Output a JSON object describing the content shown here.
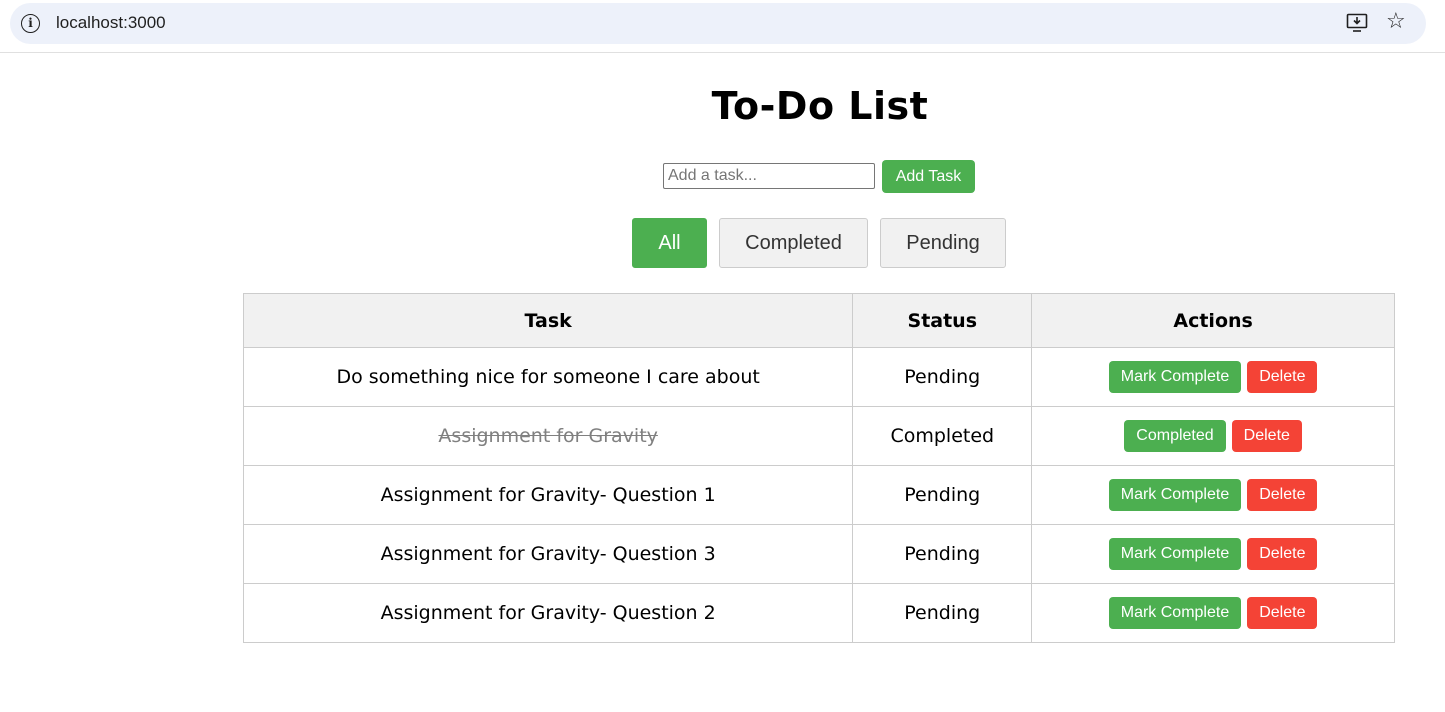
{
  "browser": {
    "url": "localhost:3000",
    "icons": {
      "info": "info-icon",
      "install": "install-app-icon",
      "bookmark": "star-icon"
    }
  },
  "app": {
    "title": "To-Do List",
    "input_placeholder": "Add a task...",
    "input_value": "",
    "add_button": "Add Task",
    "filters": [
      "All",
      "Completed",
      "Pending"
    ],
    "active_filter": "All"
  },
  "table": {
    "headers": [
      "Task",
      "Status",
      "Actions"
    ],
    "rows": [
      {
        "task": "Do something nice for someone I care about",
        "status": "Pending",
        "completed": false,
        "primary_action": "Mark Complete",
        "delete": "Delete"
      },
      {
        "task": "Assignment for Gravity",
        "status": "Completed",
        "completed": true,
        "primary_action": "Completed",
        "delete": "Delete"
      },
      {
        "task": "Assignment for Gravity- Question 1",
        "status": "Pending",
        "completed": false,
        "primary_action": "Mark Complete",
        "delete": "Delete"
      },
      {
        "task": "Assignment for Gravity- Question 3",
        "status": "Pending",
        "completed": false,
        "primary_action": "Mark Complete",
        "delete": "Delete"
      },
      {
        "task": "Assignment for Gravity- Question 2",
        "status": "Pending",
        "completed": false,
        "primary_action": "Mark Complete",
        "delete": "Delete"
      }
    ]
  },
  "colors": {
    "accent_green": "#4caf50",
    "delete_red": "#f44336",
    "header_bg": "#f1f1f1",
    "border": "#cccccc"
  }
}
